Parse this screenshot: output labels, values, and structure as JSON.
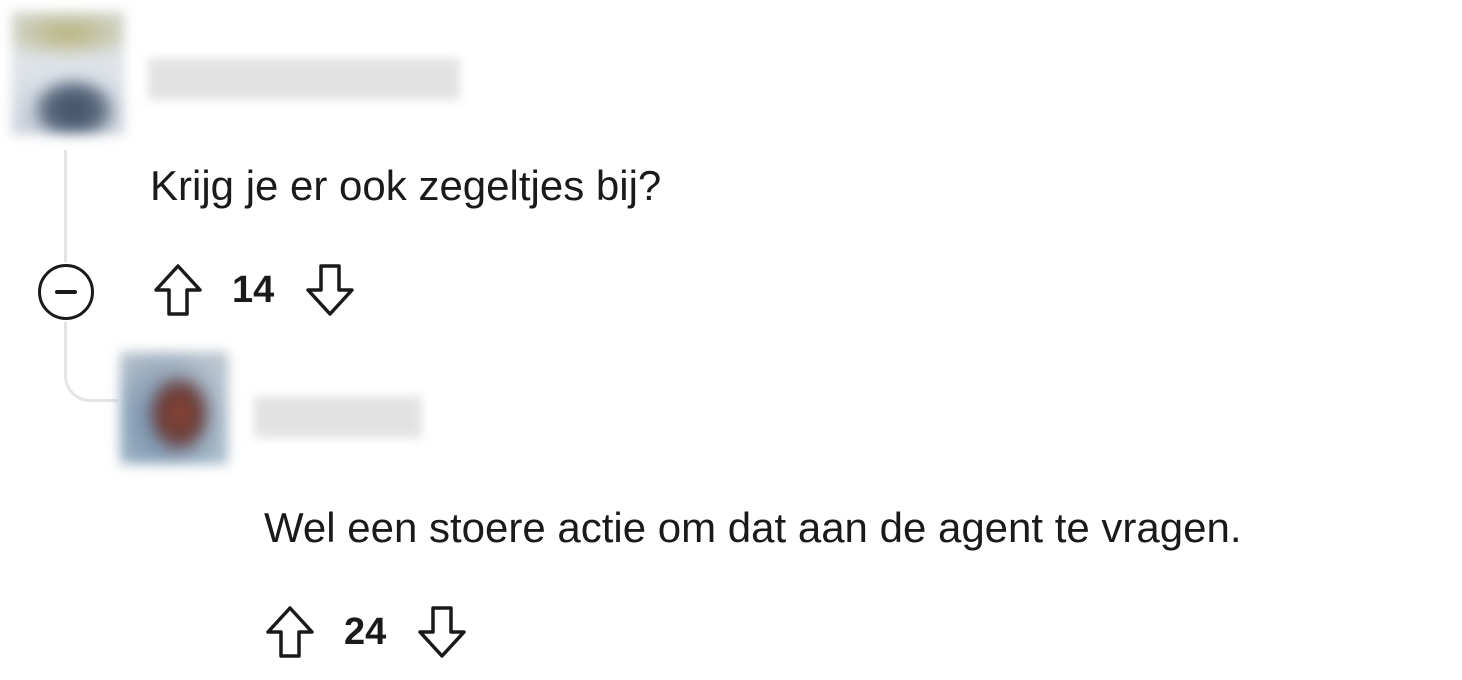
{
  "comments": [
    {
      "username": "",
      "text": "Krijg je er ook zegeltjes bij?",
      "score": "14",
      "collapse_icon": "minus-circle-icon",
      "upvote_icon": "arrow-up-outline-icon",
      "downvote_icon": "arrow-down-outline-icon"
    },
    {
      "username": "",
      "text": "Wel een stoere actie om dat aan de agent te vragen.",
      "score": "24",
      "upvote_icon": "arrow-up-outline-icon",
      "downvote_icon": "arrow-down-outline-icon"
    }
  ],
  "colors": {
    "text": "#1a1a1b",
    "thread_line": "#e5e5e5",
    "background": "#ffffff"
  }
}
